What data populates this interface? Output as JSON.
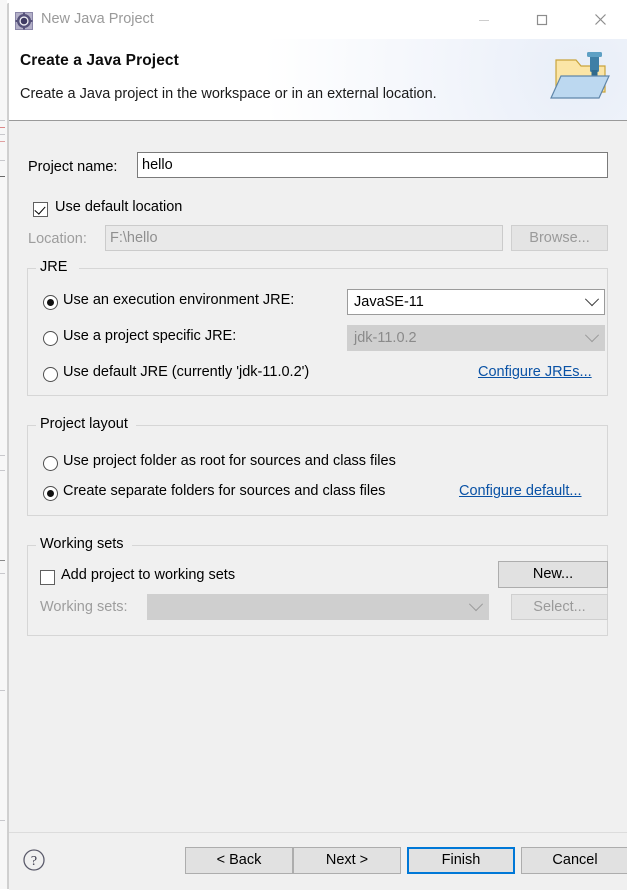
{
  "window": {
    "title": "New Java Project",
    "icon": "new-java-project-icon",
    "controls": {
      "minimize": "minimize-icon",
      "maximize": "maximize-icon",
      "close": "close-icon"
    }
  },
  "header": {
    "title": "Create a Java Project",
    "description": "Create a Java project in the workspace or in an external location.",
    "icon": "java-project-folder-icon"
  },
  "form": {
    "project_name_label": "Project name:",
    "project_name_value": "hello",
    "use_default_location_label": "Use default location",
    "use_default_location_checked": true,
    "location_label": "Location:",
    "location_value": "F:\\hello",
    "browse_label": "Browse...",
    "browse_enabled": false
  },
  "jre": {
    "group_title": "JRE",
    "options": [
      {
        "label": "Use an execution environment JRE:",
        "selected": true,
        "combo_value": "JavaSE-11",
        "combo_enabled": true
      },
      {
        "label": "Use a project specific JRE:",
        "selected": false,
        "combo_value": "jdk-11.0.2",
        "combo_enabled": false
      },
      {
        "label": "Use default JRE (currently 'jdk-11.0.2')",
        "selected": false
      }
    ],
    "configure_link": "Configure JREs..."
  },
  "project_layout": {
    "group_title": "Project layout",
    "options": [
      {
        "label": "Use project folder as root for sources and class files",
        "selected": false
      },
      {
        "label": "Create separate folders for sources and class files",
        "selected": true
      }
    ],
    "configure_link": "Configure default..."
  },
  "working_sets": {
    "group_title": "Working sets",
    "add_label": "Add project to working sets",
    "add_checked": false,
    "new_label": "New...",
    "working_sets_label": "Working sets:",
    "working_sets_value": "",
    "select_label": "Select...",
    "select_enabled": false
  },
  "footer": {
    "help_icon": "help-icon",
    "back_label": "< Back",
    "next_label": "Next >",
    "finish_label": "Finish",
    "cancel_label": "Cancel",
    "focused_button": "Finish"
  },
  "colors": {
    "accent_focus": "#0078d7",
    "link": "#0a52a5",
    "dialog_bg": "#f0f0f0",
    "header_bg": "#ffffff"
  }
}
